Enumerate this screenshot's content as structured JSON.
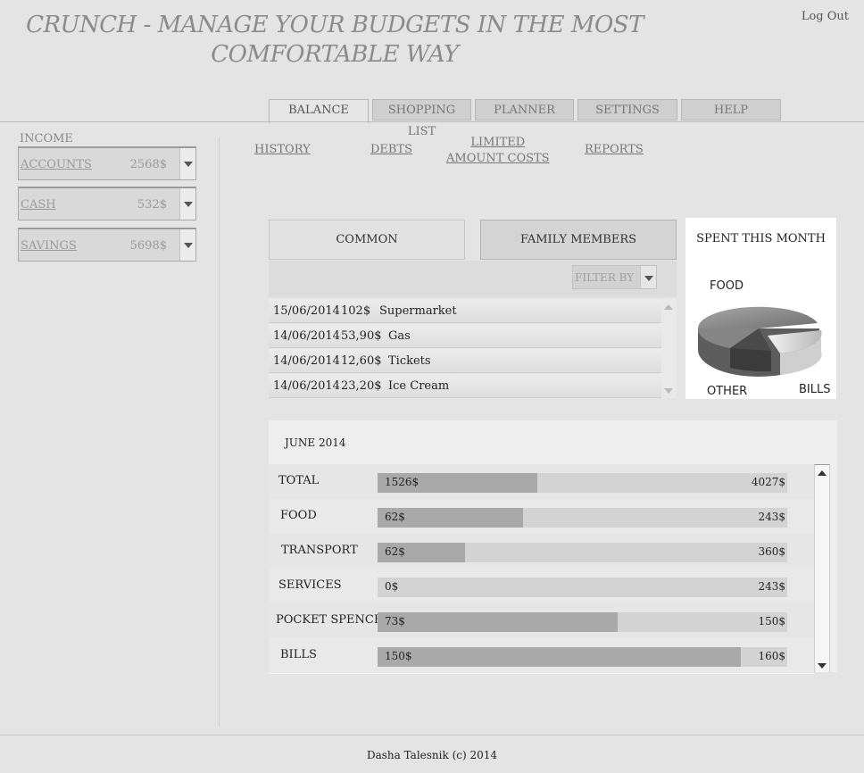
{
  "header": {
    "title_line1": "CRUNCH - MANAGE YOUR BUDGETS  IN  THE MOST",
    "title_line2": "COMFORTABLE WAY",
    "logout": "Log Out"
  },
  "tabs": [
    {
      "label": "BALANCE",
      "active": true
    },
    {
      "label": "SHOPPING LIST",
      "active": false
    },
    {
      "label": "PLANNER",
      "active": false
    },
    {
      "label": "SETTINGS",
      "active": false
    },
    {
      "label": "HELP",
      "active": false
    }
  ],
  "income": {
    "heading": "INCOME",
    "accounts": [
      {
        "label": "ACCOUNTS",
        "value": "2568$"
      },
      {
        "label": "CASH",
        "value": "532$"
      },
      {
        "label": "SAVINGS",
        "value": "5698$"
      }
    ]
  },
  "subnav": {
    "history": "HISTORY",
    "debts": "DEBTS",
    "limited_line1": "LIMITED",
    "limited_line2": "AMOUNT COSTS",
    "reports": "REPORTS"
  },
  "transactions": {
    "segments": {
      "common": "COMMON",
      "family": "FAMILY MEMBERS"
    },
    "filter_placeholder": "FILTER BY",
    "rows": [
      {
        "date": "15/06/2014",
        "amount": "102$",
        "desc": "Supermarket"
      },
      {
        "date": "14/06/2014",
        "amount": "53,90$",
        "desc": "Gas"
      },
      {
        "date": "14/06/2014",
        "amount": "12,60$",
        "desc": "Tickets"
      },
      {
        "date": "14/06/2014",
        "amount": "23,20$",
        "desc": "Ice Cream"
      }
    ]
  },
  "pie": {
    "title": "SPENT THIS MONTH",
    "labels": {
      "food": "FOOD",
      "other": "OTHER",
      "bills": "BILLS"
    }
  },
  "budget": {
    "month": "JUNE 2014",
    "rows": [
      {
        "name": "TOTAL",
        "spent": "1526$",
        "limit": "4027$",
        "progress": 0.39
      },
      {
        "name": "FOOD",
        "spent": "62$",
        "limit": "243$",
        "progress": 0.355
      },
      {
        "name": "TRANSPORT",
        "spent": "62$",
        "limit": "360$",
        "progress": 0.214
      },
      {
        "name": "SERVICES",
        "spent": "0$",
        "limit": "243$",
        "progress": 0
      },
      {
        "name": "POCKET SPENCES",
        "spent": "73$",
        "limit": "150$",
        "progress": 0.587
      },
      {
        "name": "BILLS",
        "spent": "150$",
        "limit": "160$",
        "progress": 0.887
      }
    ]
  },
  "footer": "Dasha Talesnik (c) 2014"
}
